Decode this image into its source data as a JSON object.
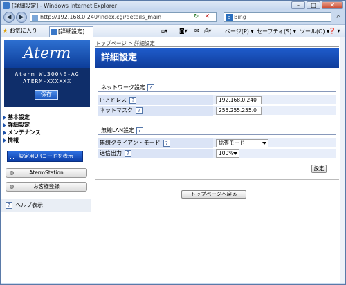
{
  "browser": {
    "window_title": "[詳細設定] - Windows Internet Explorer",
    "minimize": "–",
    "maximize": "□",
    "close": "✕",
    "address": "http://192.168.0.240/index.cgi/details_main",
    "search_placeholder": "Bing",
    "favorites_label": "お気に入り",
    "tab_label": "[詳細設定]",
    "commands": {
      "page": "ページ(P) ▾",
      "safety": "セーフティ(S) ▾",
      "tools": "ツール(O) ▾",
      "help": "❓ ▾"
    }
  },
  "sidebar": {
    "logo": "Aterm",
    "model_line1": "Aterm WL300NE-AG",
    "model_line2": "ATERM-XXXXXX",
    "save_label": "保存",
    "menu": [
      "基本設定",
      "詳細設定",
      "メンテナンス",
      "情報"
    ],
    "qr_button": "設定用QRコードを表示",
    "aterm_station": "AtermStation",
    "customer_registration": "お客様登録",
    "help_toggle": "ヘルプ表示"
  },
  "main": {
    "breadcrumb": "トップページ > 詳細設定",
    "title": "詳細設定",
    "network": {
      "section": "ネットワーク設定",
      "ip_label": "IPアドレス",
      "ip_value": "192.168.0.240",
      "mask_label": "ネットマスク",
      "mask_value": "255.255.255.0"
    },
    "wlan": {
      "section": "無線LAN設定",
      "client_mode_label": "無線クライアントモード",
      "client_mode_value": "拡張モード",
      "tx_power_label": "送信出力",
      "tx_power_value": "100%"
    },
    "set_button": "設定",
    "back_button": "トップページへ戻る",
    "help_icon": "?"
  }
}
